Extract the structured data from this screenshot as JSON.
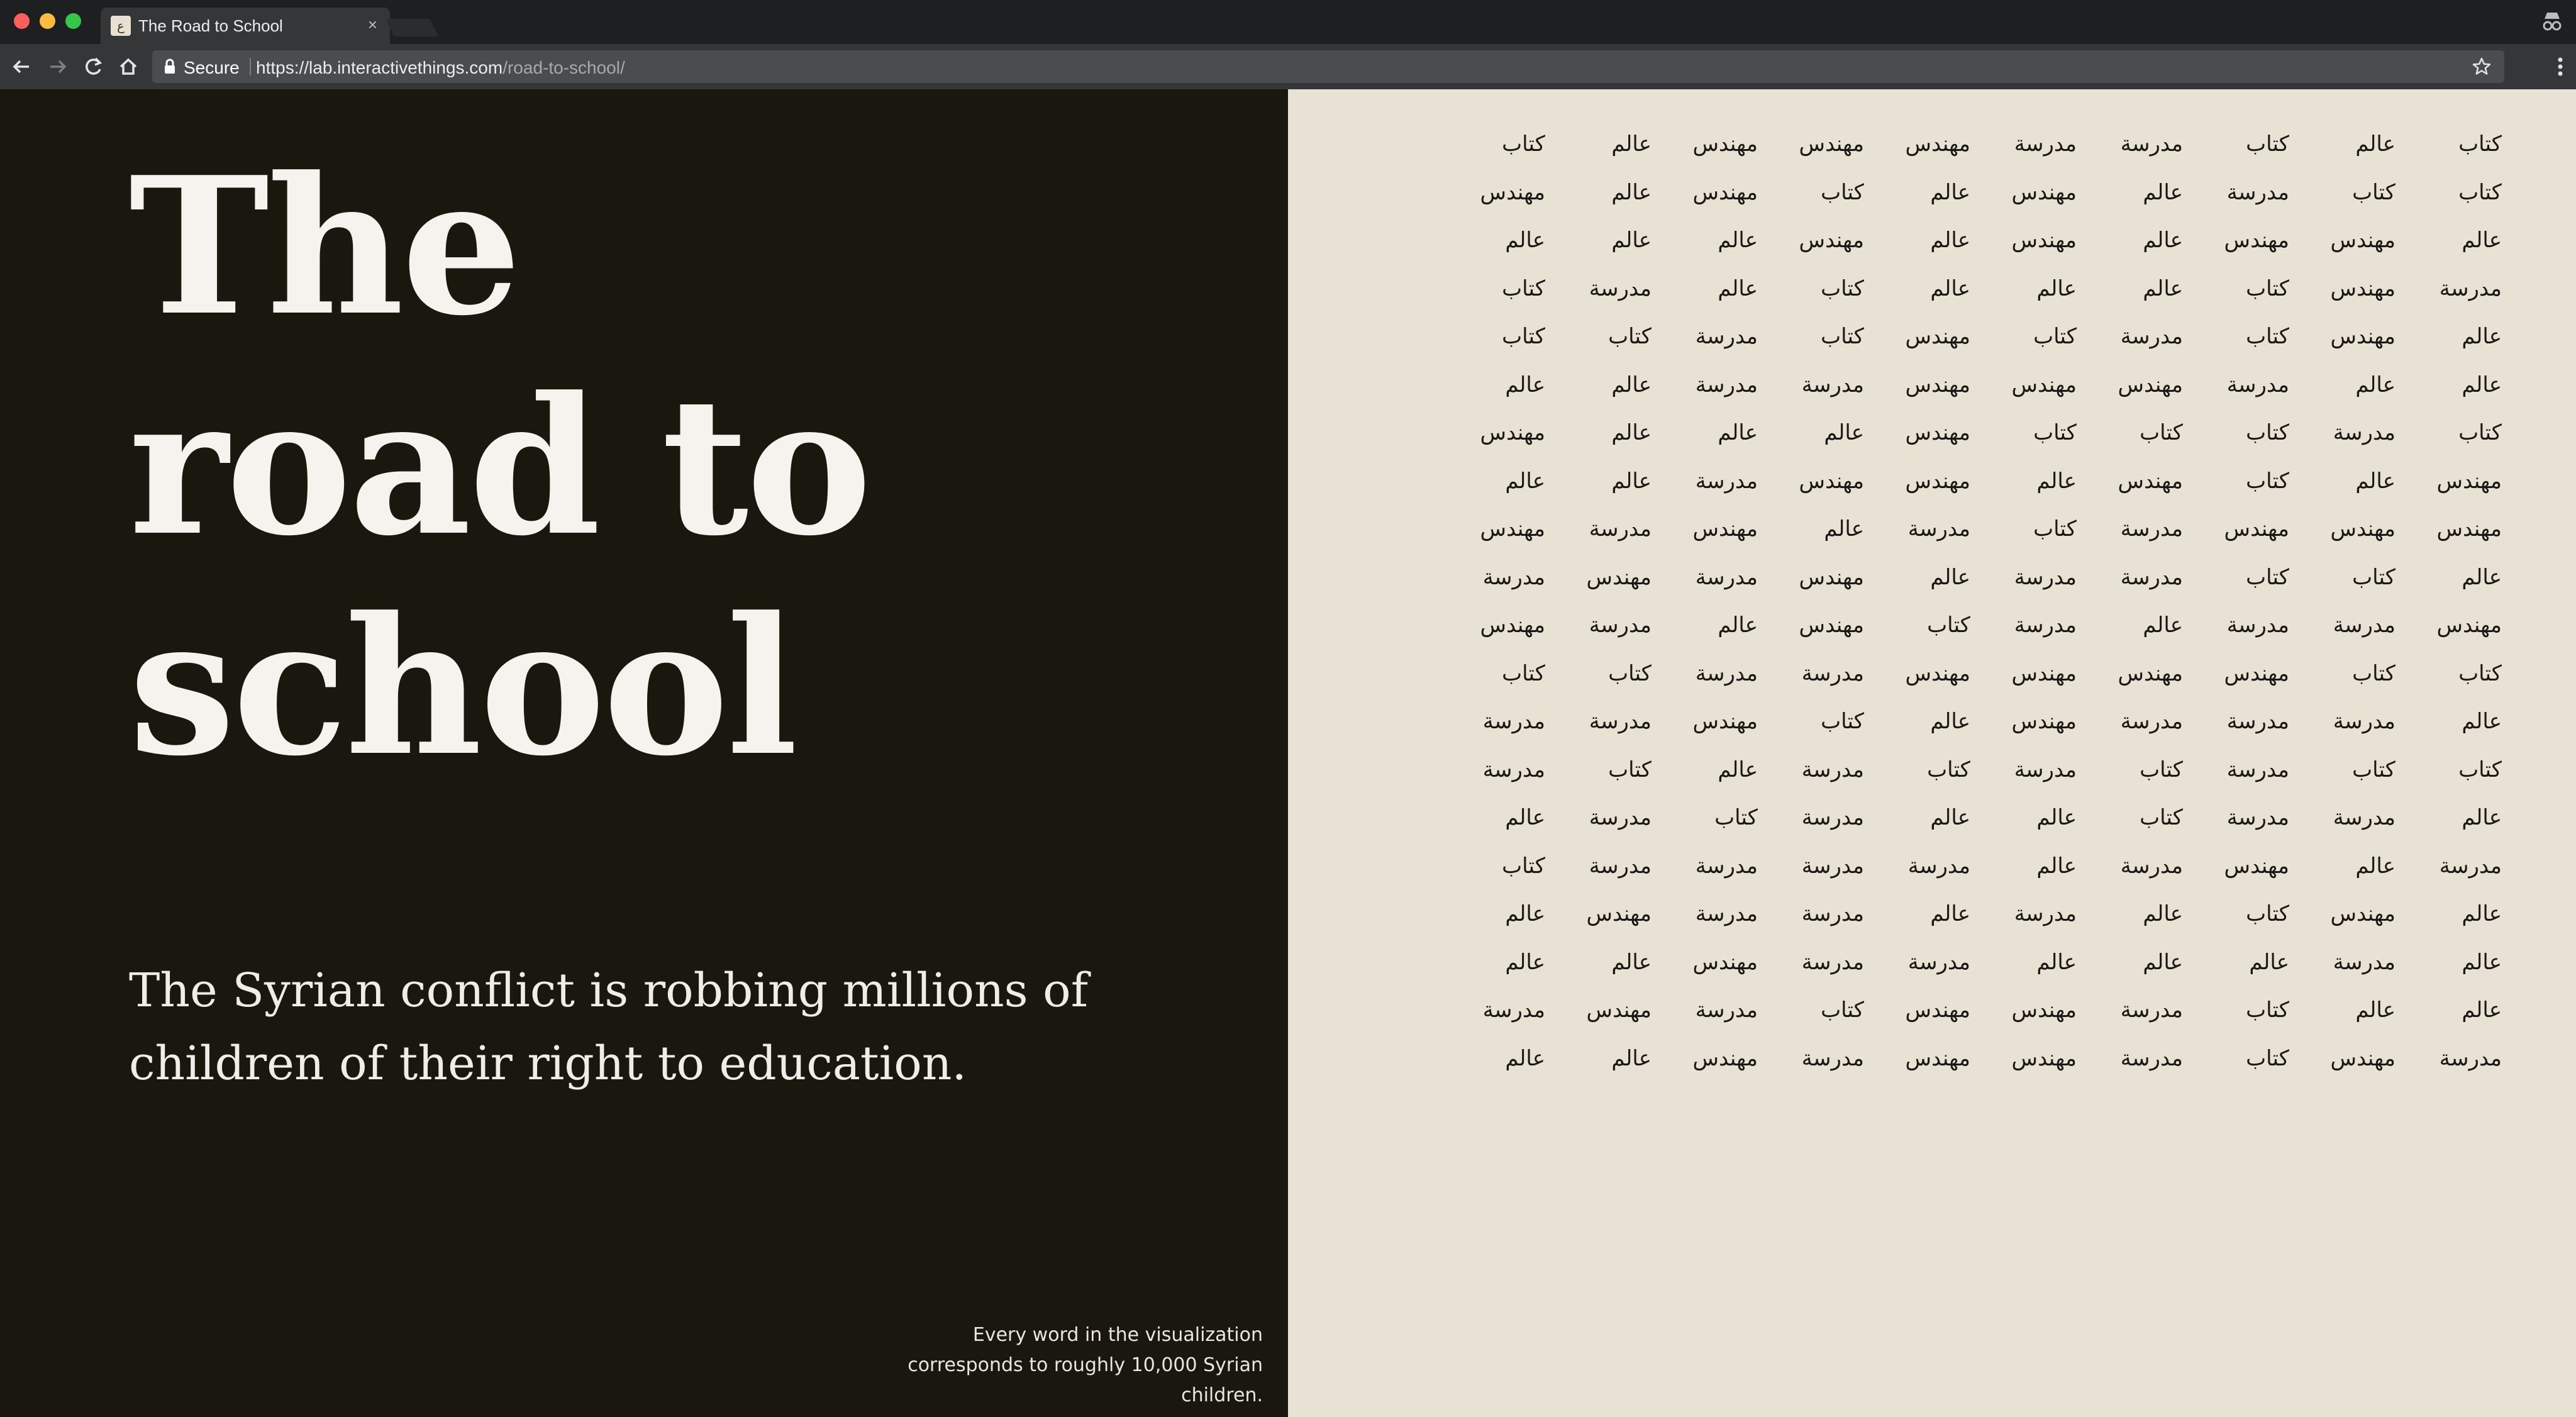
{
  "browser": {
    "tab_title": "The Road to School",
    "tab_favicon_glyph": "ع",
    "tab_close": "×",
    "secure_label": "Secure",
    "url_host": "https://lab.interactivethings.com",
    "url_path": "/road-to-school/"
  },
  "page": {
    "title_lines": [
      "The",
      "road to",
      "school"
    ],
    "subtitle": "The Syrian conflict is robbing millions of children of their right to education.",
    "footnote": "Every word in the visualization corresponds to roughly 10,000 Syrian children.",
    "colors": {
      "left_bg": "#1a170e",
      "right_bg": "#e8e2d4",
      "text_light": "#f5f3ee",
      "text_dark": "#1a1814"
    }
  },
  "word_grid": {
    "rows": [
      [
        "كتاب",
        "عالم",
        "كتاب",
        "مدرسة",
        "مدرسة",
        "مهندس",
        "مهندس",
        "مهندس",
        "عالم",
        "كتاب"
      ],
      [
        "كتاب",
        "كتاب",
        "مدرسة",
        "عالم",
        "مهندس",
        "عالم",
        "كتاب",
        "مهندس",
        "عالم",
        "مهندس"
      ],
      [
        "عالم",
        "مهندس",
        "مهندس",
        "عالم",
        "مهندس",
        "عالم",
        "مهندس",
        "عالم",
        "عالم",
        "عالم"
      ],
      [
        "مدرسة",
        "مهندس",
        "كتاب",
        "عالم",
        "عالم",
        "عالم",
        "كتاب",
        "عالم",
        "مدرسة",
        "كتاب"
      ],
      [
        "عالم",
        "مهندس",
        "كتاب",
        "مدرسة",
        "كتاب",
        "مهندس",
        "كتاب",
        "مدرسة",
        "كتاب",
        "كتاب"
      ],
      [
        "عالم",
        "عالم",
        "مدرسة",
        "مهندس",
        "مهندس",
        "مهندس",
        "مدرسة",
        "مدرسة",
        "عالم",
        "عالم"
      ],
      [
        "كتاب",
        "مدرسة",
        "كتاب",
        "كتاب",
        "كتاب",
        "مهندس",
        "عالم",
        "عالم",
        "عالم",
        "مهندس"
      ],
      [
        "مهندس",
        "عالم",
        "كتاب",
        "مهندس",
        "عالم",
        "مهندس",
        "مهندس",
        "مدرسة",
        "عالم",
        "عالم"
      ],
      [
        "مهندس",
        "مهندس",
        "مهندس",
        "مدرسة",
        "كتاب",
        "مدرسة",
        "عالم",
        "مهندس",
        "مدرسة",
        "مهندس"
      ],
      [
        "عالم",
        "كتاب",
        "كتاب",
        "مدرسة",
        "مدرسة",
        "عالم",
        "مهندس",
        "مدرسة",
        "مهندس",
        "مدرسة"
      ],
      [
        "مهندس",
        "مدرسة",
        "مدرسة",
        "عالم",
        "مدرسة",
        "كتاب",
        "مهندس",
        "عالم",
        "مدرسة",
        "مهندس"
      ],
      [
        "كتاب",
        "كتاب",
        "مهندس",
        "مهندس",
        "مهندس",
        "مهندس",
        "مدرسة",
        "مدرسة",
        "كتاب",
        "كتاب"
      ],
      [
        "عالم",
        "مدرسة",
        "مدرسة",
        "مدرسة",
        "مهندس",
        "عالم",
        "كتاب",
        "مهندس",
        "مدرسة",
        "مدرسة"
      ],
      [
        "كتاب",
        "كتاب",
        "مدرسة",
        "كتاب",
        "مدرسة",
        "كتاب",
        "مدرسة",
        "عالم",
        "كتاب",
        "مدرسة"
      ],
      [
        "عالم",
        "مدرسة",
        "مدرسة",
        "كتاب",
        "عالم",
        "عالم",
        "مدرسة",
        "كتاب",
        "مدرسة",
        "عالم"
      ],
      [
        "مدرسة",
        "عالم",
        "مهندس",
        "مدرسة",
        "عالم",
        "مدرسة",
        "مدرسة",
        "مدرسة",
        "مدرسة",
        "كتاب"
      ],
      [
        "عالم",
        "مهندس",
        "كتاب",
        "عالم",
        "مدرسة",
        "عالم",
        "مدرسة",
        "مدرسة",
        "مهندس",
        "عالم"
      ],
      [
        "عالم",
        "مدرسة",
        "عالم",
        "عالم",
        "عالم",
        "مدرسة",
        "مدرسة",
        "مهندس",
        "عالم",
        "عالم"
      ],
      [
        "عالم",
        "عالم",
        "كتاب",
        "مدرسة",
        "مهندس",
        "مهندس",
        "كتاب",
        "مدرسة",
        "مهندس",
        "مدرسة"
      ],
      [
        "مدرسة",
        "مهندس",
        "كتاب",
        "مدرسة",
        "مهندس",
        "مهندس",
        "مدرسة",
        "مهندس",
        "عالم",
        "عالم"
      ]
    ]
  }
}
